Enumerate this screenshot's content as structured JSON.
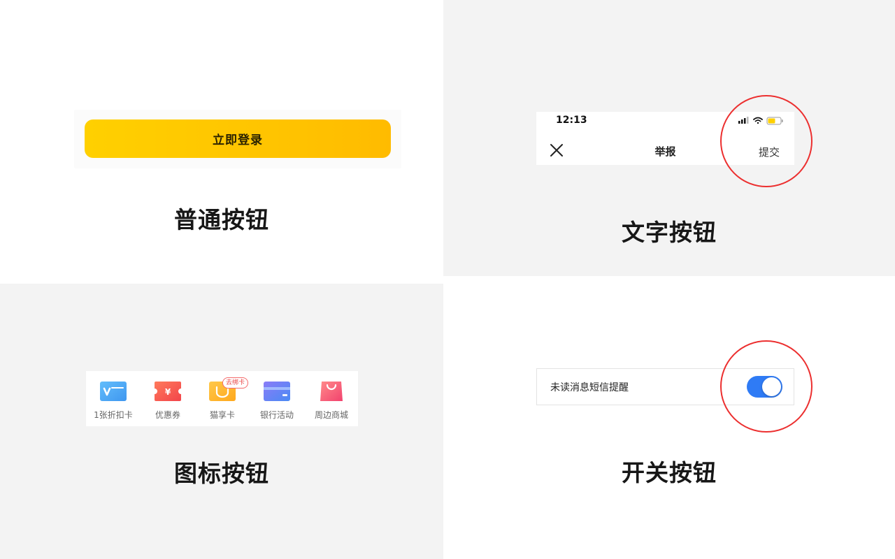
{
  "normal": {
    "button_label": "立即登录",
    "caption": "普通按钮",
    "gradient": [
      "#ffd000",
      "#ffbb00"
    ]
  },
  "text": {
    "status_time": "12:13",
    "nav_title": "举报",
    "submit_label": "提交",
    "caption": "文字按钮"
  },
  "icon": {
    "items": [
      {
        "label": "1张折扣卡",
        "icon": "discount-card-icon",
        "color": "#4aa6f5"
      },
      {
        "label": "优惠券",
        "icon": "coupon-icon",
        "color": "#f4574e",
        "glyph": "¥"
      },
      {
        "label": "猫享卡",
        "icon": "cat-card-icon",
        "color": "#ffb52b",
        "badge": "去绑卡"
      },
      {
        "label": "银行活动",
        "icon": "bank-card-icon",
        "color": "#5b7ef6"
      },
      {
        "label": "周边商城",
        "icon": "shopping-bag-icon",
        "color": "#f4577a"
      }
    ],
    "caption": "图标按钮"
  },
  "toggle": {
    "label": "未读消息短信提醒",
    "state": "on",
    "accent": "#2f7bf5",
    "caption": "开关按钮"
  },
  "highlight_color": "#ec2f2f"
}
